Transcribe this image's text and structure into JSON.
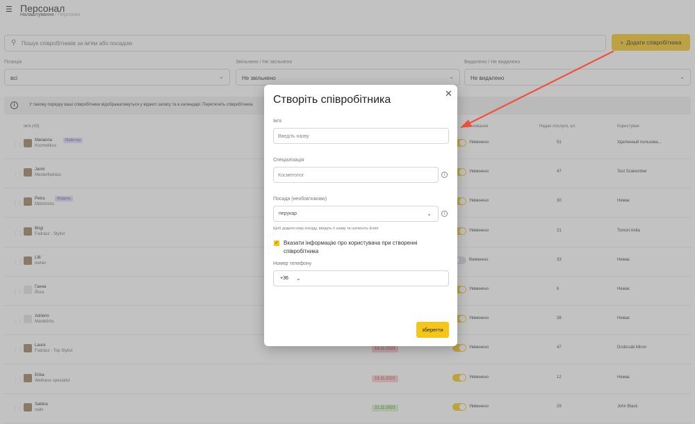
{
  "header": {
    "title": "Персонал",
    "breadcrumb": [
      "Налаштування",
      "/",
      "Персонал"
    ]
  },
  "search": {
    "placeholder": "Пошук співробітників за ім'ям або посадою"
  },
  "add_button": {
    "icon": "plus-icon",
    "label": "Додати співробітника"
  },
  "filters": [
    {
      "label": "Позиція",
      "value": "всі"
    },
    {
      "label": "Звільнено / Не звільнено",
      "value": "Не звільнено"
    },
    {
      "label": "Видалено / Не видалено",
      "value": "Не видалено"
    }
  ],
  "info_bar": {
    "text": "У такому порядку ваші співробітники відображатимуться у віджеті запису та в календарі. Перетягніть співробітника"
  },
  "table": {
    "headers": {
      "name": "Ім'я (43)",
      "booking": "бронювання",
      "services": "Надає послуги, шт.",
      "user": "Користувач"
    },
    "rows": [
      {
        "name": "Marianna",
        "sub": "Kozmetikus",
        "badge": "Майстер",
        "date": "",
        "date_color": "",
        "toggle_on": true,
        "toggle_label": "Увімкнено",
        "services": "51",
        "user": "Удаленный пользова..."
      },
      {
        "name": "Janni",
        "sub": "Mesterfodrász",
        "badge": "",
        "date": "",
        "date_color": "",
        "toggle_on": true,
        "toggle_label": "Увімкнено",
        "services": "47",
        "user": "Test Szakember"
      },
      {
        "name": "Petra",
        "sub": "Műkörmös",
        "badge": "Модель",
        "date": "",
        "date_color": "",
        "toggle_on": true,
        "toggle_label": "Увімкнено",
        "services": "30",
        "user": "Немає"
      },
      {
        "name": "Brigi",
        "sub": "Fodrász - Stylist",
        "badge": "",
        "date": "",
        "date_color": "",
        "toggle_on": true,
        "toggle_label": "Увімкнено",
        "services": "21",
        "user": "Tomori Anita"
      },
      {
        "name": "Lilli",
        "sub": "owner",
        "badge": "",
        "date": "",
        "date_color": "",
        "toggle_on": false,
        "toggle_label": "Вимкнено",
        "services": "33",
        "user": "Немає"
      },
      {
        "name": "Ганна",
        "sub": "Йога",
        "badge": "",
        "date": "",
        "date_color": "",
        "toggle_on": true,
        "toggle_label": "Увімкнено",
        "services": "6",
        "user": "Немає"
      },
      {
        "name": "Adrienn",
        "sub": "Manikűrös",
        "badge": "",
        "date": "",
        "date_color": "",
        "toggle_on": true,
        "toggle_label": "Увімкнено",
        "services": "38",
        "user": "Немає"
      },
      {
        "name": "Laura",
        "sub": "Fodrász - Top Stylist",
        "badge": "",
        "date": "18.11.2023",
        "date_color": "red",
        "toggle_on": true,
        "toggle_label": "Увімкнено",
        "services": "47",
        "user": "Drobcsák Miron"
      },
      {
        "name": "Erika",
        "sub": "Wellness specialist",
        "badge": "",
        "date": "16.11.2022",
        "date_color": "red",
        "toggle_on": true,
        "toggle_label": "Увімкнено",
        "services": "12",
        "user": "Немає"
      },
      {
        "name": "Sabina",
        "sub": "nails",
        "badge": "",
        "date": "21.11.2023",
        "date_color": "green",
        "toggle_on": true,
        "toggle_label": "Увімкнено",
        "services": "29",
        "user": "John Black"
      }
    ]
  },
  "modal": {
    "title": "Створіть співробітника",
    "name_label": "Ім'я",
    "name_placeholder": "Введіть назву",
    "spec_label": "Спеціалізація",
    "spec_placeholder": "Косметолог",
    "position_label": "Посада (необов'язково)",
    "position_value": "перукар",
    "position_hint": "Щоб додати нову посаду, введіть її назву та натисніть Enter",
    "checkbox_checked": true,
    "checkbox_label": "Вказати інформацію про користувача при створенні співробітника",
    "phone_label": "Номер телефону",
    "phone_code": "+36",
    "save_label": "зберегти"
  },
  "colors": {
    "accent": "#f5c518",
    "arrow": "#f0513c",
    "overlay": "rgba(120,120,120,0.45)"
  }
}
